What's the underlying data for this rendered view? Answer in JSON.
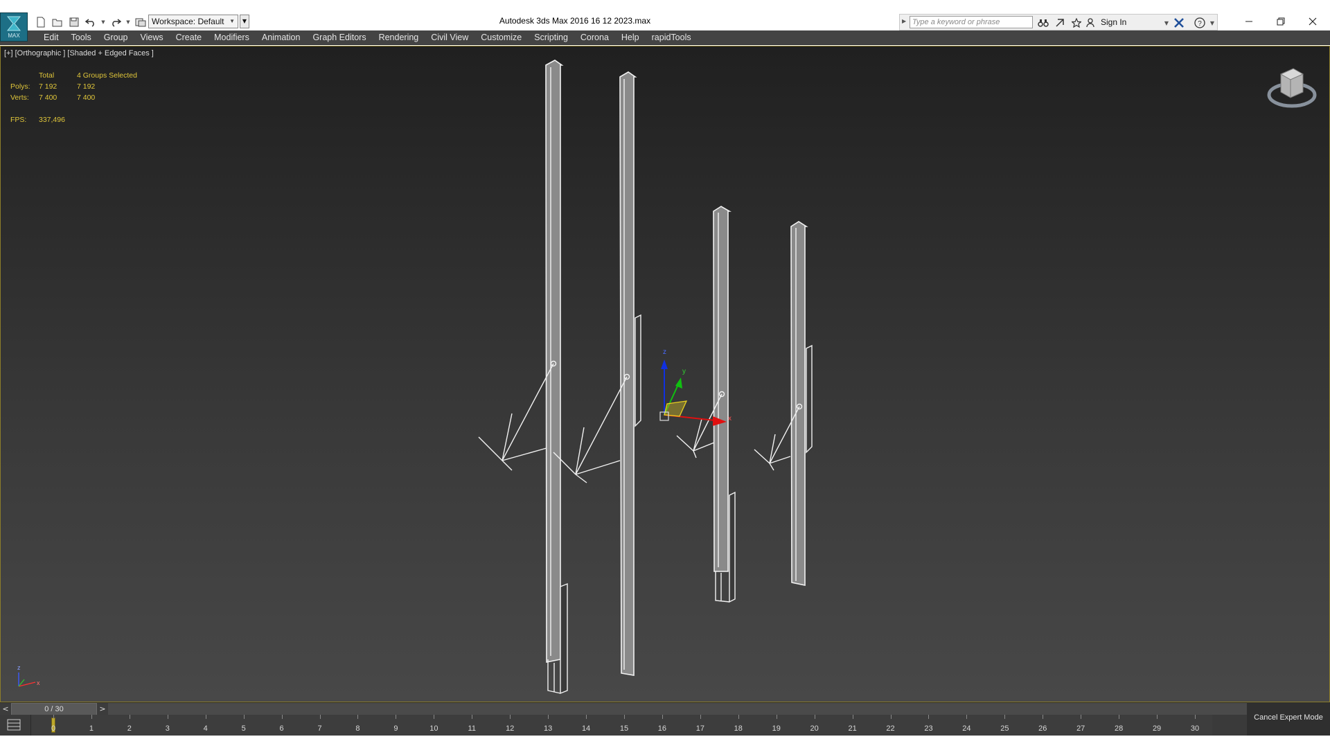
{
  "titlebar": {
    "app_logo_text": "MAX",
    "workspace_label": "Workspace: Default",
    "title": "Autodesk 3ds Max 2016    16 12 2023.max",
    "search_placeholder": "Type a keyword or phrase",
    "sign_in": "Sign In"
  },
  "menu": {
    "items": [
      "Edit",
      "Tools",
      "Group",
      "Views",
      "Create",
      "Modifiers",
      "Animation",
      "Graph Editors",
      "Rendering",
      "Civil View",
      "Customize",
      "Scripting",
      "Corona",
      "Help",
      "rapidTools"
    ]
  },
  "viewport": {
    "label": "[+] [Orthographic ] [Shaded + Edged Faces ]",
    "stats": {
      "col_total": "Total",
      "col_selected": "4 Groups Selected",
      "polys_label": "Polys:",
      "polys_total": "7 192",
      "polys_selected": "7 192",
      "verts_label": "Verts:",
      "verts_total": "7 400",
      "verts_selected": "7 400",
      "fps_label": "FPS:",
      "fps_value": "337,496"
    },
    "gizmo_axes": [
      "z",
      "y",
      "x"
    ],
    "corner_axes": [
      "z",
      "x"
    ]
  },
  "timeslider": {
    "position": "0 / 30",
    "prev": "<",
    "next": ">",
    "current_frame": 0,
    "total_frames": 30
  },
  "trackbar": {
    "ticks": [
      "0",
      "1",
      "2",
      "3",
      "4",
      "5",
      "6",
      "7",
      "8",
      "9",
      "10",
      "11",
      "12",
      "13",
      "14",
      "15",
      "16",
      "17",
      "18",
      "19",
      "20",
      "21",
      "22",
      "23",
      "24",
      "25",
      "26",
      "27",
      "28",
      "29",
      "30"
    ]
  },
  "expert": {
    "cancel_label": "Cancel Expert Mode"
  },
  "colors": {
    "stats_text": "#e0c63a",
    "viewport_border": "#8c7d2a",
    "gizmo_x": "#e01010",
    "gizmo_y": "#10c010",
    "gizmo_z": "#1030e0"
  }
}
